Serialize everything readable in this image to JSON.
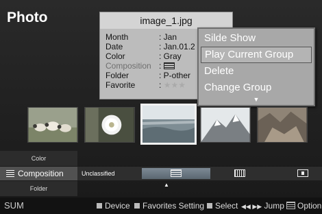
{
  "app": {
    "title": "Photo"
  },
  "info": {
    "filename": "image_1.jpg",
    "rows": [
      {
        "label": "Month",
        "value": ": Jan"
      },
      {
        "label": "Date",
        "value": ": Jan.01.2"
      },
      {
        "label": "Color",
        "value": ": Gray"
      },
      {
        "label": "Composition",
        "value": ":"
      },
      {
        "label": "Folder",
        "value": ": P-other"
      },
      {
        "label": "Favorite",
        "value": ":"
      }
    ],
    "favorite_stars": "★★★"
  },
  "menu": {
    "items": [
      "Silde Show",
      "Play Current Group",
      "Delete",
      "Change Group"
    ],
    "selected": "Play Current Group",
    "more": "▼"
  },
  "thumbnails": [
    {
      "subject": "sheep",
      "selected": false
    },
    {
      "subject": "flower",
      "selected": false
    },
    {
      "subject": "sea",
      "selected": true
    },
    {
      "subject": "mountain",
      "selected": false
    },
    {
      "subject": "rocks",
      "selected": false
    }
  ],
  "categories": {
    "above": "Color",
    "current": "Composition",
    "below": "Folder",
    "unclassified": "Unclassified",
    "pointer": "▲"
  },
  "status": {
    "title": "SUM",
    "device": "Device",
    "favorites": "Favorites Setting",
    "select": "Select",
    "jump_arrows": "◀◀ ▶▶",
    "jump": "Jump",
    "option": "Option"
  },
  "colors": {
    "panel": "#bcbcbc",
    "menu": "#a8a8a8",
    "active_segment": "#6f7b86"
  }
}
